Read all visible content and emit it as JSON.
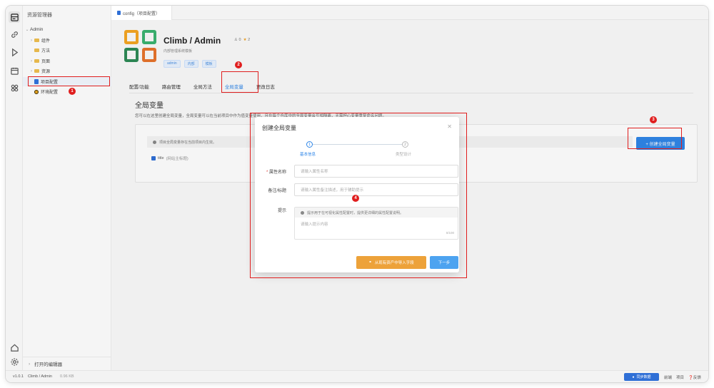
{
  "sidebar": {
    "title": "资源管理器",
    "root": "Admin",
    "items": [
      {
        "label": "组件",
        "type": "folder"
      },
      {
        "label": "方法",
        "type": "folder"
      },
      {
        "label": "页面",
        "type": "folder"
      },
      {
        "label": "资源",
        "type": "folder"
      },
      {
        "label": "项目配置",
        "type": "config"
      },
      {
        "label": "环境配置",
        "type": "env"
      }
    ],
    "open_editors": "打开的编辑器"
  },
  "tab": {
    "label": "config（项目配置）"
  },
  "project": {
    "title": "Climb / Admin",
    "likes": "0",
    "stars": "2",
    "description": "内部管理系统模板",
    "tags": [
      "admin",
      "内部",
      "模板"
    ],
    "logo_colors": [
      "#f5a623",
      "#3cb371",
      "#2e8b57",
      "#e8742c"
    ]
  },
  "nav": {
    "tabs": [
      "配置/功能",
      "路由管理",
      "全局方法",
      "全局变量",
      "更改日志"
    ],
    "active": "全局变量"
  },
  "section": {
    "title": "全局变量",
    "description": "您可以在这里创建全局变量，全局变量可以在当前项目中作为值变量使用，且在每个仓库中的全局变量会互相隔离，无需担心变量重复命名问题。"
  },
  "card": {
    "info": "项目全局变量存在当前项目内生效。",
    "field_name": "title",
    "field_desc": "(网站主标题)"
  },
  "create_button": "+ 创建全局变量",
  "dialog": {
    "title": "创建全局变量",
    "steps": [
      {
        "num": "1",
        "label": "基本信息"
      },
      {
        "num": "2",
        "label": "类型设计"
      }
    ],
    "name_label": "属性名称",
    "name_placeholder": "请输入属性名称",
    "remark_label": "备注/标题",
    "remark_placeholder": "请输入属性备注描述，用于辅助提示",
    "hint_label": "提示",
    "hint_info": "提示用于在可视化属性配置时，提供更详细的属性配置说明。",
    "hint_placeholder": "请输入提示内容",
    "hint_count": "0/100",
    "import_button": "从现有资产中导入字段",
    "next_button": "下一步"
  },
  "markers": [
    "1",
    "2",
    "3",
    "4"
  ],
  "status": {
    "version": "v1.0.1",
    "path": "Climb / Admin",
    "size": "0.96 KB",
    "sync": "同步数据",
    "links": [
      "前端",
      "项目",
      "反馈"
    ]
  },
  "colors": {
    "accent": "#2f86e8",
    "annotation": "#e01e1e",
    "orange": "#eda23a"
  }
}
